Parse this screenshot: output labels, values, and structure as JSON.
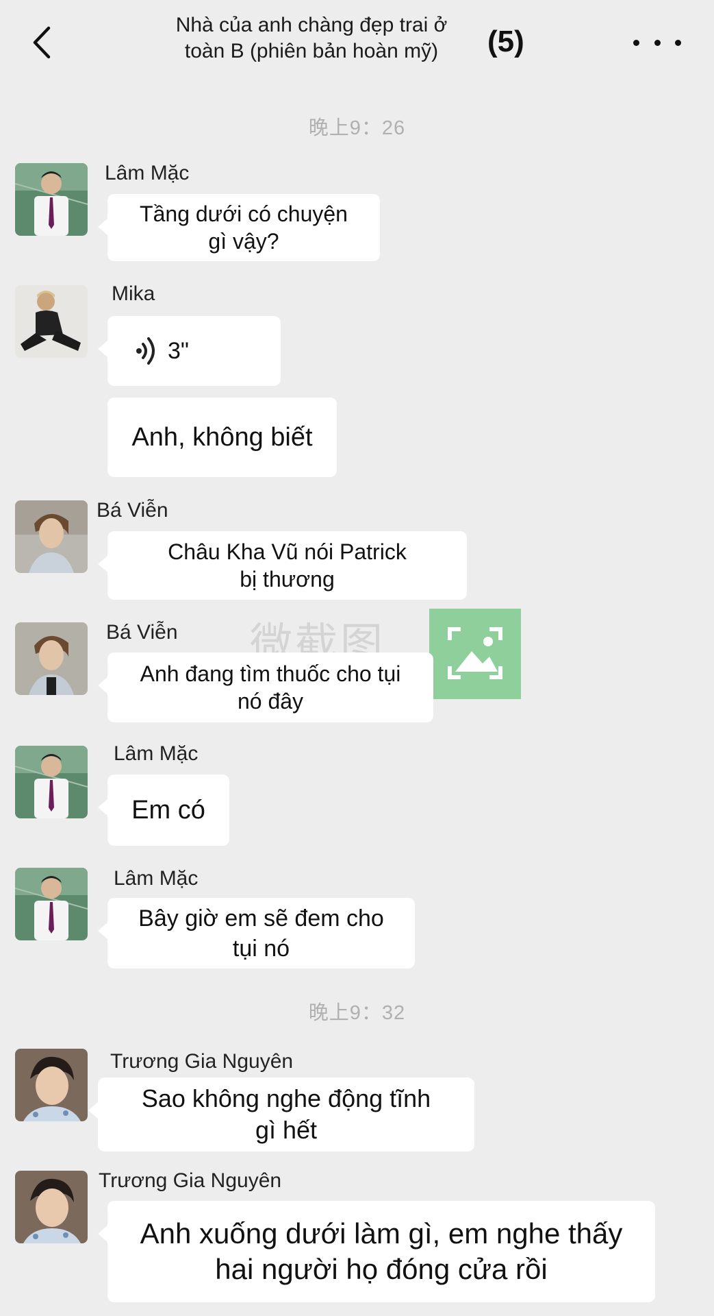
{
  "header": {
    "title_line1": "Nhà của anh chàng đẹp trai ở",
    "title_line2": "toàn B (phiên bản hoàn mỹ)",
    "member_count": "(5)"
  },
  "timestamps": [
    "晚上9：26",
    "晚上9：32"
  ],
  "watermark": {
    "text": "微截图"
  },
  "messages": [
    {
      "sender": "Lâm Mặc",
      "lines": [
        "Tầng dưới có chuyện",
        "gì vậy?"
      ]
    },
    {
      "sender": "Mika",
      "voice_duration": "3\""
    },
    {
      "text": "Anh, không biết"
    },
    {
      "sender": "Bá Viễn",
      "lines": [
        "Châu Kha Vũ nói Patrick",
        "bị thương"
      ]
    },
    {
      "sender": "Bá Viễn",
      "lines": [
        "Anh đang tìm thuốc cho tụi",
        "nó đây"
      ]
    },
    {
      "sender": "Lâm Mặc",
      "text": "Em có"
    },
    {
      "sender": "Lâm Mặc",
      "lines": [
        "Bây giờ em sẽ đem cho",
        "tụi nó"
      ]
    },
    {
      "sender": "Trương Gia Nguyên",
      "lines": [
        "Sao không nghe động tĩnh",
        "gì hết"
      ]
    },
    {
      "sender": "Trương Gia Nguyên",
      "lines": [
        "Anh xuống dưới làm gì, em nghe thấy",
        "hai người họ đóng cửa rồi"
      ]
    }
  ],
  "colors": {
    "background": "#ededed",
    "bubble": "#ffffff",
    "timestamp": "#b0b0b0",
    "watermark_icon": "#8fcf9b"
  }
}
